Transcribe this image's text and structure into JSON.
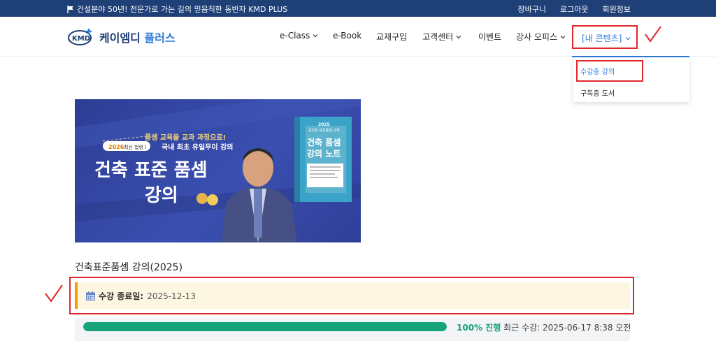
{
  "topbar": {
    "notice": "건설분야 50년! 전문가로 가는 길의 믿음직한 동반자 KMD PLUS",
    "links": [
      "장바구니",
      "로그아웃",
      "회원정보"
    ]
  },
  "logo": {
    "mark": "KMD",
    "name_main": "케이엠디",
    "name_sub": "플러스"
  },
  "nav": {
    "items": [
      {
        "label": "e-Class",
        "has_chevron": true
      },
      {
        "label": "e-Book",
        "has_chevron": false
      },
      {
        "label": "교재구입",
        "has_chevron": false
      },
      {
        "label": "고객센터",
        "has_chevron": true
      },
      {
        "label": "이벤트",
        "has_chevron": false
      },
      {
        "label": "강사 오피스",
        "has_chevron": true
      },
      {
        "label": "[내 콘텐츠]",
        "has_chevron": true
      }
    ]
  },
  "dropdown": {
    "items": [
      "수강중 강의",
      "구독중 도서"
    ],
    "active_index": 0
  },
  "banner": {
    "badge_top": "최신 법령",
    "badge_year": "2026",
    "badge_rest": "최신 법령 !",
    "slogan_line1": "품셈 교육을 교과 과정으로!",
    "slogan_line2": "국내 최초 유일무이 강의",
    "headline_line1": "건축 표준 품셈",
    "headline_line2": "강의",
    "book_year": "2025",
    "book_subtitle": "공인된 표준품셈 교재",
    "book_title_line1": "건축 품셈",
    "book_title_line2": "강의 노트"
  },
  "course": {
    "title": "건축표준품셈 강의(2025)",
    "end_label": "수강 종료일:",
    "end_date": "2025-12-13",
    "progress_pct_label": "100% 진행",
    "progress_value": 1.0,
    "last_access_label": "최근 수강:",
    "last_access": "2025-06-17 8:38 오전"
  },
  "colors": {
    "topbar": "#1f3f77",
    "brand_blue": "#2a7bd6",
    "annotation_red": "#e0282c",
    "progress_green": "#15a37a",
    "end_bg": "#fdf6e1",
    "end_border": "#f0a000"
  },
  "icons": {
    "notice": "flag-icon",
    "calendar": "calendar-icon",
    "chevron": "chevron-down-icon"
  }
}
